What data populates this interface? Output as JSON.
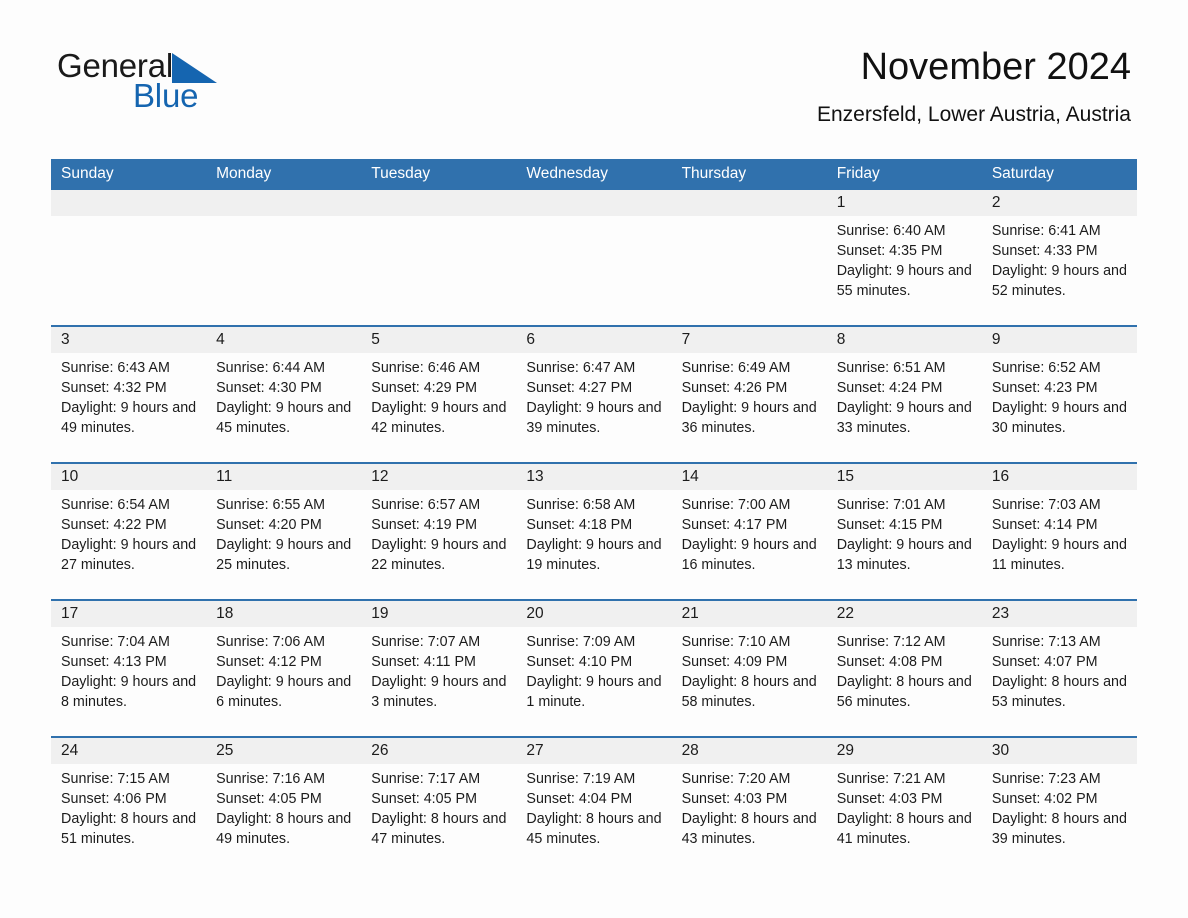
{
  "brand": {
    "name_part1": "General",
    "name_part2": "Blue",
    "logo_icon": "triangle-sail-icon",
    "accent_color": "#1565b0"
  },
  "header": {
    "title": "November 2024",
    "subtitle": "Enzersfeld, Lower Austria, Austria"
  },
  "colors": {
    "header_blue": "#3071ad",
    "daynum_band": "#f0f0f0",
    "row_divider": "#3071ad",
    "text": "#1c1c1c"
  },
  "calendar": {
    "weekday_headers": [
      "Sunday",
      "Monday",
      "Tuesday",
      "Wednesday",
      "Thursday",
      "Friday",
      "Saturday"
    ],
    "weeks": [
      [
        {
          "day": "",
          "sunrise": "",
          "sunset": "",
          "daylight": "",
          "empty": true
        },
        {
          "day": "",
          "sunrise": "",
          "sunset": "",
          "daylight": "",
          "empty": true
        },
        {
          "day": "",
          "sunrise": "",
          "sunset": "",
          "daylight": "",
          "empty": true
        },
        {
          "day": "",
          "sunrise": "",
          "sunset": "",
          "daylight": "",
          "empty": true
        },
        {
          "day": "",
          "sunrise": "",
          "sunset": "",
          "daylight": "",
          "empty": true
        },
        {
          "day": "1",
          "sunrise": "Sunrise: 6:40 AM",
          "sunset": "Sunset: 4:35 PM",
          "daylight": "Daylight: 9 hours and 55 minutes."
        },
        {
          "day": "2",
          "sunrise": "Sunrise: 6:41 AM",
          "sunset": "Sunset: 4:33 PM",
          "daylight": "Daylight: 9 hours and 52 minutes."
        }
      ],
      [
        {
          "day": "3",
          "sunrise": "Sunrise: 6:43 AM",
          "sunset": "Sunset: 4:32 PM",
          "daylight": "Daylight: 9 hours and 49 minutes."
        },
        {
          "day": "4",
          "sunrise": "Sunrise: 6:44 AM",
          "sunset": "Sunset: 4:30 PM",
          "daylight": "Daylight: 9 hours and 45 minutes."
        },
        {
          "day": "5",
          "sunrise": "Sunrise: 6:46 AM",
          "sunset": "Sunset: 4:29 PM",
          "daylight": "Daylight: 9 hours and 42 minutes."
        },
        {
          "day": "6",
          "sunrise": "Sunrise: 6:47 AM",
          "sunset": "Sunset: 4:27 PM",
          "daylight": "Daylight: 9 hours and 39 minutes."
        },
        {
          "day": "7",
          "sunrise": "Sunrise: 6:49 AM",
          "sunset": "Sunset: 4:26 PM",
          "daylight": "Daylight: 9 hours and 36 minutes."
        },
        {
          "day": "8",
          "sunrise": "Sunrise: 6:51 AM",
          "sunset": "Sunset: 4:24 PM",
          "daylight": "Daylight: 9 hours and 33 minutes."
        },
        {
          "day": "9",
          "sunrise": "Sunrise: 6:52 AM",
          "sunset": "Sunset: 4:23 PM",
          "daylight": "Daylight: 9 hours and 30 minutes."
        }
      ],
      [
        {
          "day": "10",
          "sunrise": "Sunrise: 6:54 AM",
          "sunset": "Sunset: 4:22 PM",
          "daylight": "Daylight: 9 hours and 27 minutes."
        },
        {
          "day": "11",
          "sunrise": "Sunrise: 6:55 AM",
          "sunset": "Sunset: 4:20 PM",
          "daylight": "Daylight: 9 hours and 25 minutes."
        },
        {
          "day": "12",
          "sunrise": "Sunrise: 6:57 AM",
          "sunset": "Sunset: 4:19 PM",
          "daylight": "Daylight: 9 hours and 22 minutes."
        },
        {
          "day": "13",
          "sunrise": "Sunrise: 6:58 AM",
          "sunset": "Sunset: 4:18 PM",
          "daylight": "Daylight: 9 hours and 19 minutes."
        },
        {
          "day": "14",
          "sunrise": "Sunrise: 7:00 AM",
          "sunset": "Sunset: 4:17 PM",
          "daylight": "Daylight: 9 hours and 16 minutes."
        },
        {
          "day": "15",
          "sunrise": "Sunrise: 7:01 AM",
          "sunset": "Sunset: 4:15 PM",
          "daylight": "Daylight: 9 hours and 13 minutes."
        },
        {
          "day": "16",
          "sunrise": "Sunrise: 7:03 AM",
          "sunset": "Sunset: 4:14 PM",
          "daylight": "Daylight: 9 hours and 11 minutes."
        }
      ],
      [
        {
          "day": "17",
          "sunrise": "Sunrise: 7:04 AM",
          "sunset": "Sunset: 4:13 PM",
          "daylight": "Daylight: 9 hours and 8 minutes."
        },
        {
          "day": "18",
          "sunrise": "Sunrise: 7:06 AM",
          "sunset": "Sunset: 4:12 PM",
          "daylight": "Daylight: 9 hours and 6 minutes."
        },
        {
          "day": "19",
          "sunrise": "Sunrise: 7:07 AM",
          "sunset": "Sunset: 4:11 PM",
          "daylight": "Daylight: 9 hours and 3 minutes."
        },
        {
          "day": "20",
          "sunrise": "Sunrise: 7:09 AM",
          "sunset": "Sunset: 4:10 PM",
          "daylight": "Daylight: 9 hours and 1 minute."
        },
        {
          "day": "21",
          "sunrise": "Sunrise: 7:10 AM",
          "sunset": "Sunset: 4:09 PM",
          "daylight": "Daylight: 8 hours and 58 minutes."
        },
        {
          "day": "22",
          "sunrise": "Sunrise: 7:12 AM",
          "sunset": "Sunset: 4:08 PM",
          "daylight": "Daylight: 8 hours and 56 minutes."
        },
        {
          "day": "23",
          "sunrise": "Sunrise: 7:13 AM",
          "sunset": "Sunset: 4:07 PM",
          "daylight": "Daylight: 8 hours and 53 minutes."
        }
      ],
      [
        {
          "day": "24",
          "sunrise": "Sunrise: 7:15 AM",
          "sunset": "Sunset: 4:06 PM",
          "daylight": "Daylight: 8 hours and 51 minutes."
        },
        {
          "day": "25",
          "sunrise": "Sunrise: 7:16 AM",
          "sunset": "Sunset: 4:05 PM",
          "daylight": "Daylight: 8 hours and 49 minutes."
        },
        {
          "day": "26",
          "sunrise": "Sunrise: 7:17 AM",
          "sunset": "Sunset: 4:05 PM",
          "daylight": "Daylight: 8 hours and 47 minutes."
        },
        {
          "day": "27",
          "sunrise": "Sunrise: 7:19 AM",
          "sunset": "Sunset: 4:04 PM",
          "daylight": "Daylight: 8 hours and 45 minutes."
        },
        {
          "day": "28",
          "sunrise": "Sunrise: 7:20 AM",
          "sunset": "Sunset: 4:03 PM",
          "daylight": "Daylight: 8 hours and 43 minutes."
        },
        {
          "day": "29",
          "sunrise": "Sunrise: 7:21 AM",
          "sunset": "Sunset: 4:03 PM",
          "daylight": "Daylight: 8 hours and 41 minutes."
        },
        {
          "day": "30",
          "sunrise": "Sunrise: 7:23 AM",
          "sunset": "Sunset: 4:02 PM",
          "daylight": "Daylight: 8 hours and 39 minutes."
        }
      ]
    ]
  }
}
